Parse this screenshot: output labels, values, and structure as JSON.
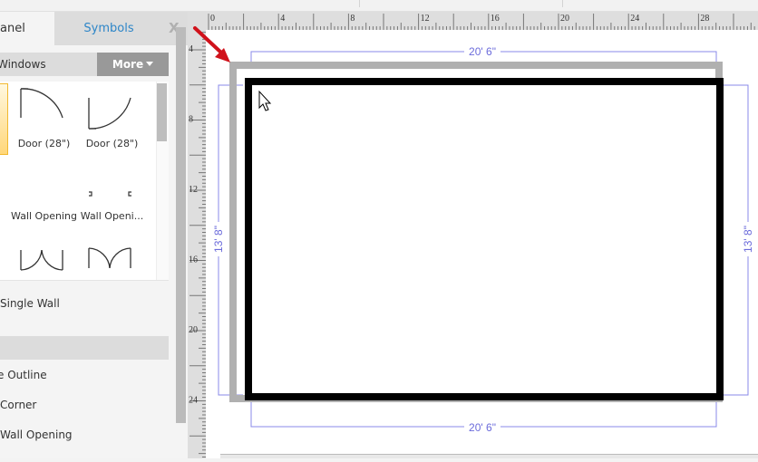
{
  "panel": {
    "tab_active_label": "Panel",
    "tab_active_visible": "anel",
    "tab_symbols_label": "Symbols",
    "close_label": "X",
    "category_title": "Windows",
    "category_title_visible": "Windows",
    "more_label": "More",
    "shapes": [
      {
        "label": "",
        "icon": "selected-shape-icon"
      },
      {
        "label": "Door (28\")",
        "icon": "door-left-swing-icon"
      },
      {
        "label": "Door (28\")",
        "icon": "door-right-swing-icon"
      },
      {
        "label": "Wall Opening",
        "icon": "wall-opening-icon"
      },
      {
        "label": "Wall Openi...",
        "icon": "wall-opening-brackets-icon"
      },
      {
        "label": "",
        "icon": "double-door-down-icon"
      },
      {
        "label": "",
        "icon": "double-door-up-icon"
      }
    ],
    "list_items": [
      {
        "label": "Single Wall"
      },
      {
        "label": "e Outline"
      },
      {
        "label": "Corner"
      },
      {
        "label": "Wall Opening"
      }
    ]
  },
  "ruler": {
    "horizontal_labels": [
      "0",
      "4",
      "8",
      "12",
      "16",
      "20",
      "24",
      "28"
    ],
    "vertical_labels": [
      "4",
      "8",
      "12",
      "16",
      "20",
      "24"
    ]
  },
  "drawing": {
    "dimension_top": "20' 6\"",
    "dimension_bottom": "20' 6\"",
    "dimension_left": "13' 8\"",
    "dimension_right": "13' 8\"",
    "colors": {
      "wall": "#000000",
      "shadow_wall": "#b0b0b0",
      "dimension": "#6b6bdb",
      "arrow": "#d0121b"
    }
  }
}
